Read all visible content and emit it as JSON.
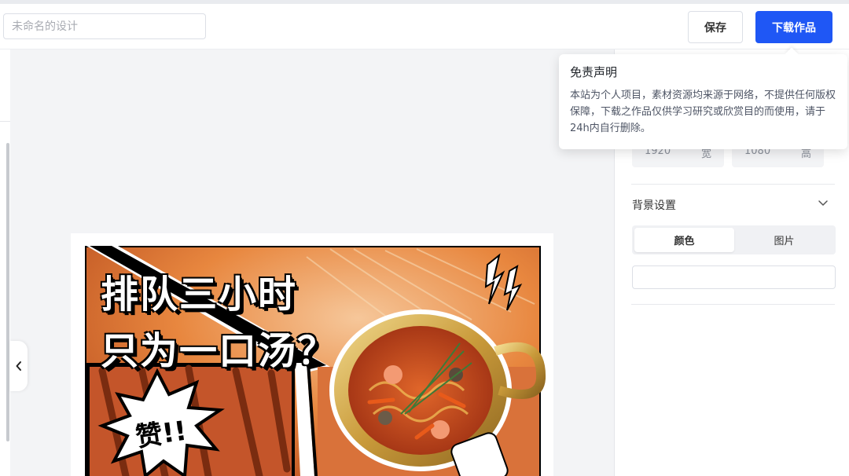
{
  "header": {
    "design_name_placeholder": "未命名的设计",
    "save_label": "保存",
    "download_label": "下载作品"
  },
  "disclaimer": {
    "title": "免责声明",
    "body": "本站为个人项目，素材资源均来源于网络，不提供任何版权保障，下载之作品仅供学习研究或欣赏目的而使用，请于24h内自行删除。"
  },
  "canvas_size": {
    "width_value": "1920",
    "width_unit": "宽",
    "height_value": "1080",
    "height_unit": "高"
  },
  "background": {
    "section_title": "背景设置",
    "tabs": [
      {
        "label": "颜色",
        "active": true
      },
      {
        "label": "图片",
        "active": false
      }
    ]
  },
  "poster": {
    "headline_line1": "排队三小时",
    "headline_line2": "只为一口汤？",
    "burst_text": "赞!!"
  },
  "colors": {
    "primary": "#1f57f5",
    "poster_orange": "#e8793a",
    "soup_red": "#c2441c",
    "pot_gold": "#d7b052"
  },
  "icons": {
    "collapse": "chevron-left-icon",
    "section_toggle": "chevron-down-icon"
  }
}
